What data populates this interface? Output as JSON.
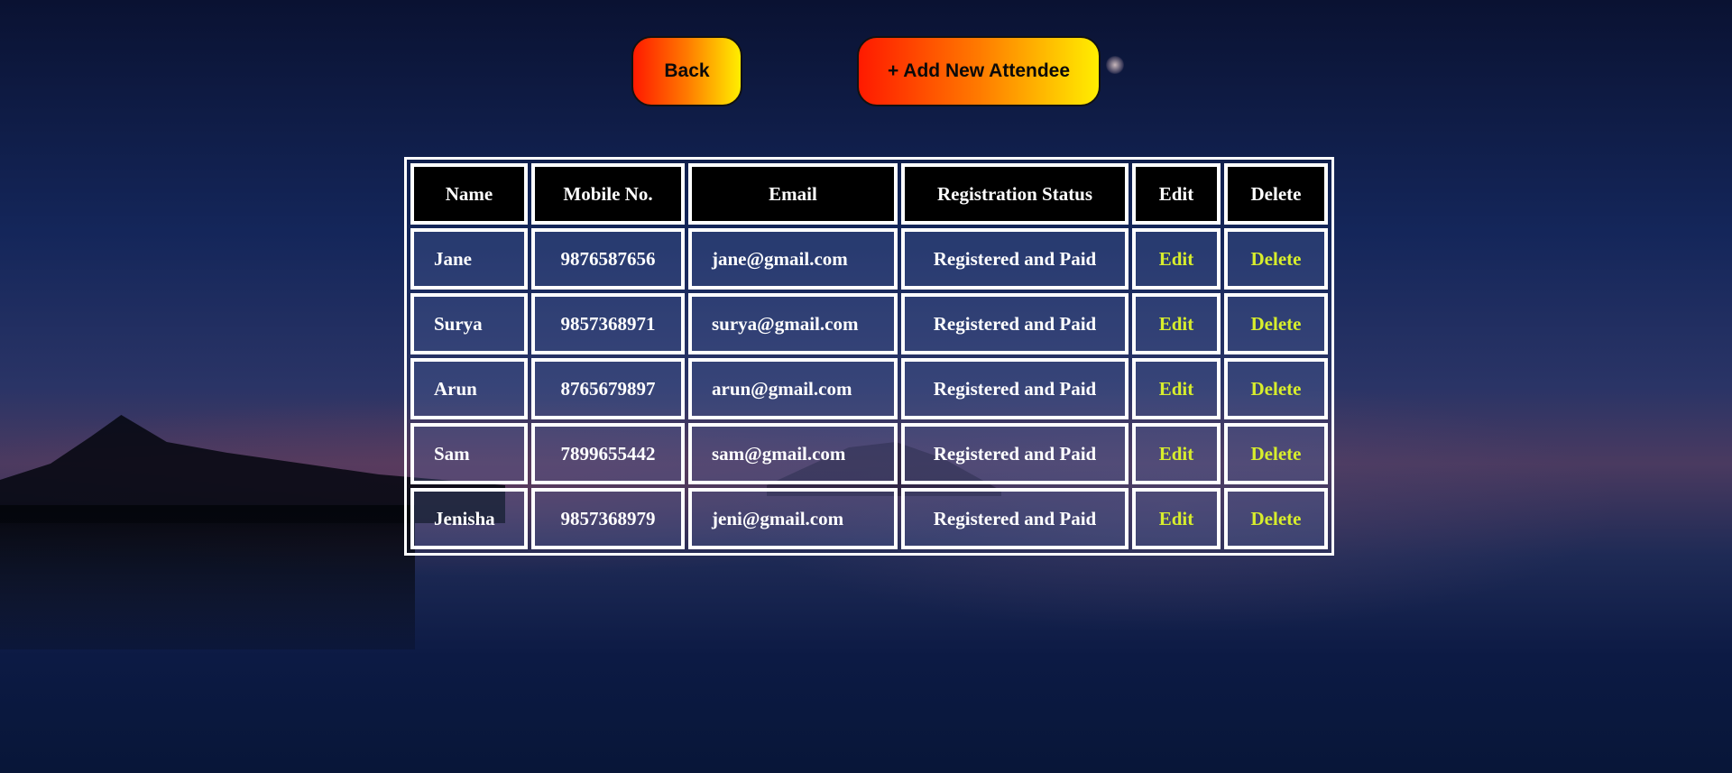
{
  "toolbar": {
    "back_label": "Back",
    "add_label": "+ Add New Attendee"
  },
  "table": {
    "headers": [
      "Name",
      "Mobile No.",
      "Email",
      "Registration Status",
      "Edit",
      "Delete"
    ],
    "rows": [
      {
        "name": "Jane",
        "mobile": "9876587656",
        "email": "jane@gmail.com",
        "status": "Registered and Paid",
        "edit": "Edit",
        "delete": "Delete"
      },
      {
        "name": "Surya",
        "mobile": "9857368971",
        "email": "surya@gmail.com",
        "status": "Registered and Paid",
        "edit": "Edit",
        "delete": "Delete"
      },
      {
        "name": "Arun",
        "mobile": "8765679897",
        "email": "arun@gmail.com",
        "status": "Registered and Paid",
        "edit": "Edit",
        "delete": "Delete"
      },
      {
        "name": "Sam",
        "mobile": "7899655442",
        "email": "sam@gmail.com",
        "status": "Registered and Paid",
        "edit": "Edit",
        "delete": "Delete"
      },
      {
        "name": "Jenisha",
        "mobile": "9857368979",
        "email": "jeni@gmail.com",
        "status": "Registered and Paid",
        "edit": "Edit",
        "delete": "Delete"
      }
    ]
  },
  "colors": {
    "button_gradient_start": "#ff1a00",
    "button_gradient_mid": "#ff7a00",
    "button_gradient_end": "#ffee00",
    "header_bg": "#000000",
    "action_link": "#d8ee2c",
    "cell_text": "#ffffff"
  }
}
